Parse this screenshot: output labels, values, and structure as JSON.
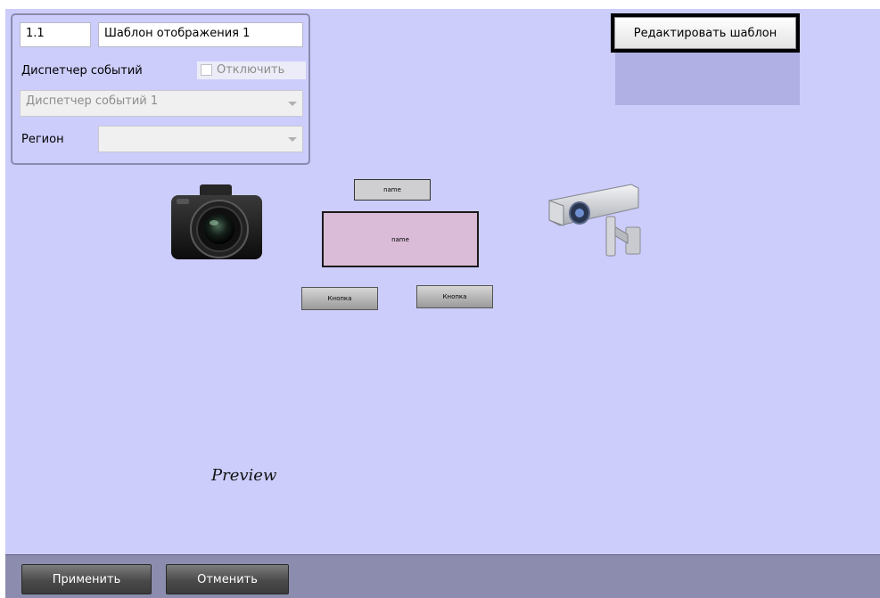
{
  "panel": {
    "id_value": "1.1",
    "name_value": "Шаблон отображения 1",
    "event_manager_label": "Диспетчер событий",
    "disable_label": "Отключить",
    "event_manager_value": "Диспетчер событий 1",
    "region_label": "Регион",
    "region_value": ""
  },
  "toolbar": {
    "edit_template_label": "Редактировать шаблон"
  },
  "preview": {
    "title_element_label": "name",
    "body_element_label": "name",
    "button1_label": "Кнопка",
    "button2_label": "Кнопка",
    "caption": "Preview"
  },
  "icons": {
    "camera": "photo-camera-icon",
    "cctv": "cctv-camera-icon"
  },
  "bottom_bar": {
    "apply_label": "Применить",
    "cancel_label": "Отменить"
  }
}
